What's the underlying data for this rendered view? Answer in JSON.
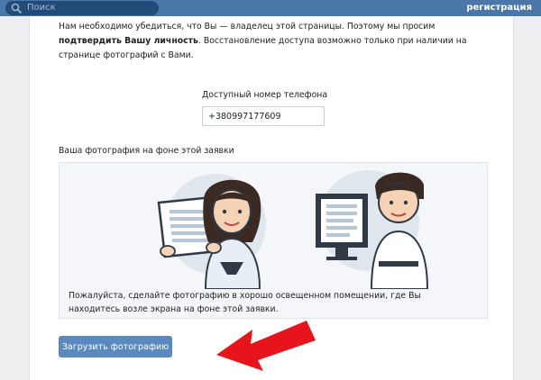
{
  "header": {
    "search_placeholder": "Поиск",
    "register_link": "регистрация",
    "search_icon": "search-icon",
    "colors": {
      "bar": "#4a76a8",
      "search_bg": "#224b7a"
    }
  },
  "intro": {
    "text_before": "Нам необходимо убедиться, что Вы — владелец этой страницы. Поэтому мы просим ",
    "text_bold": "подтвердить Вашу личность",
    "text_after": ". Восстановление доступа возможно только при наличии на странице фотографий с Вами."
  },
  "phone": {
    "label": "Доступный номер телефона",
    "value": "+380997177609"
  },
  "photo": {
    "label": "Ваша фотография на фоне этой заявки",
    "caption": "Пожалуйста, сделайте фотографию в хорошо освещенном помещении, где Вы находитесь возле экрана на фоне этой заявки."
  },
  "actions": {
    "upload_label": "Загрузить фотографию",
    "accent": "#5b88bd"
  },
  "annotation": {
    "arrow_color": "#e8141c"
  }
}
